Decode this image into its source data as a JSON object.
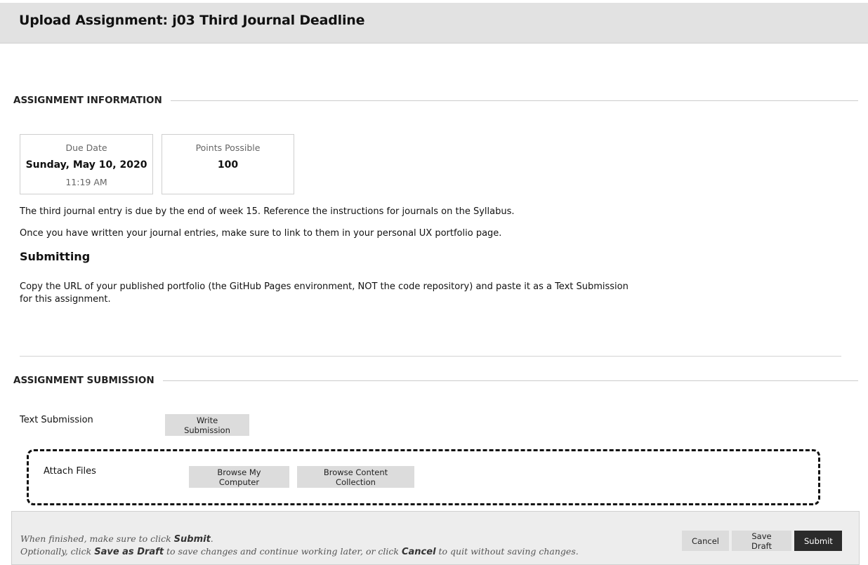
{
  "header": {
    "title": "Upload Assignment: j03 Third Journal Deadline"
  },
  "assignment_info": {
    "section_title": "ASSIGNMENT INFORMATION",
    "due_date": {
      "label": "Due Date",
      "value": "Sunday, May 10, 2020",
      "time": "11:19 AM"
    },
    "points": {
      "label": "Points Possible",
      "value": "100"
    },
    "paragraph_1": "The third journal entry is due by the end of week 15. Reference the instructions for journals on the Syllabus.",
    "paragraph_2": "Once you have written your journal entries, make sure to link to them in your personal UX portfolio page.",
    "submitting_heading": "Submitting",
    "submitting_text": "Copy the URL of your published portfolio (the GitHub Pages environment, NOT the code repository) and paste it as a Text Submission for this assignment."
  },
  "assignment_submission": {
    "section_title": "ASSIGNMENT SUBMISSION",
    "text_submission_label": "Text Submission",
    "write_submission_button": "Write Submission",
    "attach_files_label": "Attach Files",
    "browse_computer_button": "Browse My Computer",
    "browse_content_button": "Browse Content Collection"
  },
  "footer": {
    "line1_prefix": "When finished, make sure to click ",
    "line1_submit": "Submit",
    "line1_suffix": ".",
    "line2_prefix": "Optionally, click ",
    "line2_save": "Save as Draft",
    "line2_middle": " to save changes and continue working later, or click ",
    "line2_cancel": "Cancel",
    "line2_suffix": " to quit without saving changes.",
    "cancel_button": "Cancel",
    "save_draft_button": "Save Draft",
    "submit_button": "Submit"
  },
  "colors": {
    "header_bg": "#e2e2e2",
    "button_bg": "#dcdcdc",
    "submit_bg": "#2b2b2b",
    "footer_bg": "#ededed"
  }
}
